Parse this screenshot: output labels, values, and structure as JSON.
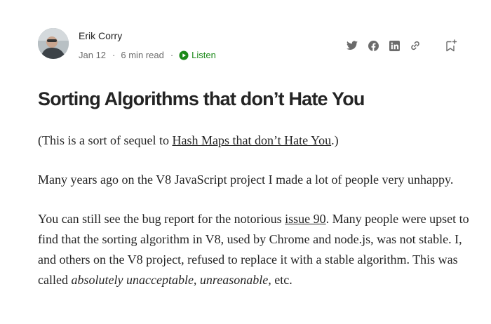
{
  "author": {
    "name": "Erik Corry",
    "date": "Jan 12",
    "read_time": "6 min read",
    "separator": "·",
    "listen_label": "Listen"
  },
  "icons": {
    "share": [
      "twitter-icon",
      "facebook-icon",
      "linkedin-icon",
      "link-icon"
    ],
    "save": "bookmark-add-icon",
    "listen": "play-circle-icon"
  },
  "colors": {
    "text": "#242424",
    "muted": "#6b6b6b",
    "listen": "#1a8917"
  },
  "article": {
    "title": "Sorting Algorithms that don’t Hate You",
    "p1": {
      "before": "(This is a sort of sequel to ",
      "link": "Hash Maps that don’t Hate You",
      "after": ".)"
    },
    "p2": "Many years ago on the V8 JavaScript project I made a lot of people very unhappy.",
    "p3": {
      "before": "You can still see the bug report for the notorious ",
      "link": "issue 90",
      "middle": ". Many people were upset to find that the sorting algorithm in V8, used by Chrome and node.js, was not stable. I, and others on the V8 project, refused to replace it with a stable algorithm. This was called ",
      "emphasis": "absolutely unacceptable, unreasonable,",
      "after": " etc."
    }
  }
}
